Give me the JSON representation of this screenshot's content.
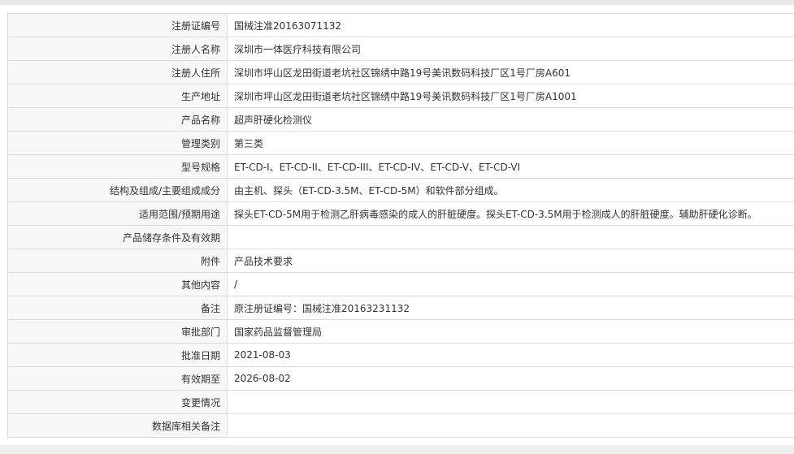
{
  "registration": {
    "rows": [
      {
        "label": "注册证编号",
        "value": "国械注准20163071132"
      },
      {
        "label": "注册人名称",
        "value": "深圳市一体医疗科技有限公司"
      },
      {
        "label": "注册人住所",
        "value": "深圳市坪山区龙田街道老坑社区锦绣中路19号美讯数码科技厂区1号厂房A601"
      },
      {
        "label": "生产地址",
        "value": "深圳市坪山区龙田街道老坑社区锦绣中路19号美讯数码科技厂区1号厂房A1001"
      },
      {
        "label": "产品名称",
        "value": "超声肝硬化检测仪"
      },
      {
        "label": "管理类别",
        "value": "第三类"
      },
      {
        "label": "型号规格",
        "value": "ET-CD-I、ET-CD-II、ET-CD-III、ET-CD-IV、ET-CD-V、ET-CD-VI"
      },
      {
        "label": "结构及组成/主要组成成分",
        "value": "由主机、探头（ET-CD-3.5M、ET-CD-5M）和软件部分组成。"
      },
      {
        "label": "适用范围/预期用途",
        "value": "探头ET-CD-5M用于检测乙肝病毒感染的成人的肝脏硬度。探头ET-CD-3.5M用于检测成人的肝脏硬度。辅助肝硬化诊断。"
      },
      {
        "label": "产品储存条件及有效期",
        "value": ""
      },
      {
        "label": "附件",
        "value": "产品技术要求"
      },
      {
        "label": "其他内容",
        "value": "/"
      },
      {
        "label": "备注",
        "value": "原注册证编号：国械注准20163231132"
      },
      {
        "label": "审批部门",
        "value": "国家药品监督管理局"
      },
      {
        "label": "批准日期",
        "value": "2021-08-03"
      },
      {
        "label": "有效期至",
        "value": "2026-08-02"
      },
      {
        "label": "变更情况",
        "value": ""
      },
      {
        "label": "数据库相关备注",
        "value": ""
      }
    ]
  }
}
